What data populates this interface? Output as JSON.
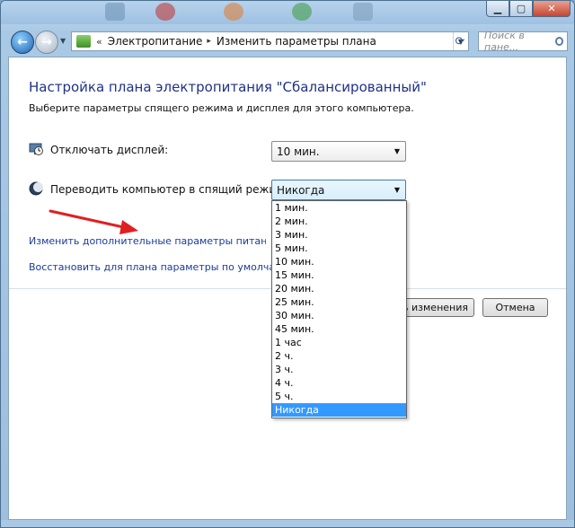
{
  "window": {
    "controls": {
      "minimize": "▁",
      "maximize": "▢",
      "close": "✕"
    }
  },
  "navigation": {
    "address_chevron": "«",
    "breadcrumbs": [
      "Электропитание",
      "Изменить параметры плана"
    ],
    "crumb_separator": "▸",
    "search_placeholder": "Поиск в пане..."
  },
  "page": {
    "title": "Настройка плана электропитания \"Сбалансированный\"",
    "subtitle": "Выберите параметры спящего режима и дисплея для этого компьютера.",
    "display_off": {
      "label": "Отключать дисплей:",
      "value": "10 мин.",
      "icon": "monitor-clock-icon"
    },
    "sleep": {
      "label": "Переводить компьютер в спящий режим:",
      "value": "Никогда",
      "icon": "moon-icon"
    },
    "sleep_options": [
      "1 мин.",
      "2 мин.",
      "3 мин.",
      "5 мин.",
      "10 мин.",
      "15 мин.",
      "20 мин.",
      "25 мин.",
      "30 мин.",
      "45 мин.",
      "1 час",
      "2 ч.",
      "3 ч.",
      "4 ч.",
      "5 ч.",
      "Никогда"
    ],
    "sleep_selected_index": 15,
    "link_advanced": "Изменить дополнительные параметры питания",
    "link_restore": "Восстановить для плана параметры по умолчанию",
    "save_button": "Сохранить изменения",
    "cancel_button": "Отмена"
  },
  "colors": {
    "title_blue": "#1e3287",
    "link_blue": "#1a3c9a",
    "selection": "#3399ff",
    "annotation_arrow": "#e02020"
  }
}
